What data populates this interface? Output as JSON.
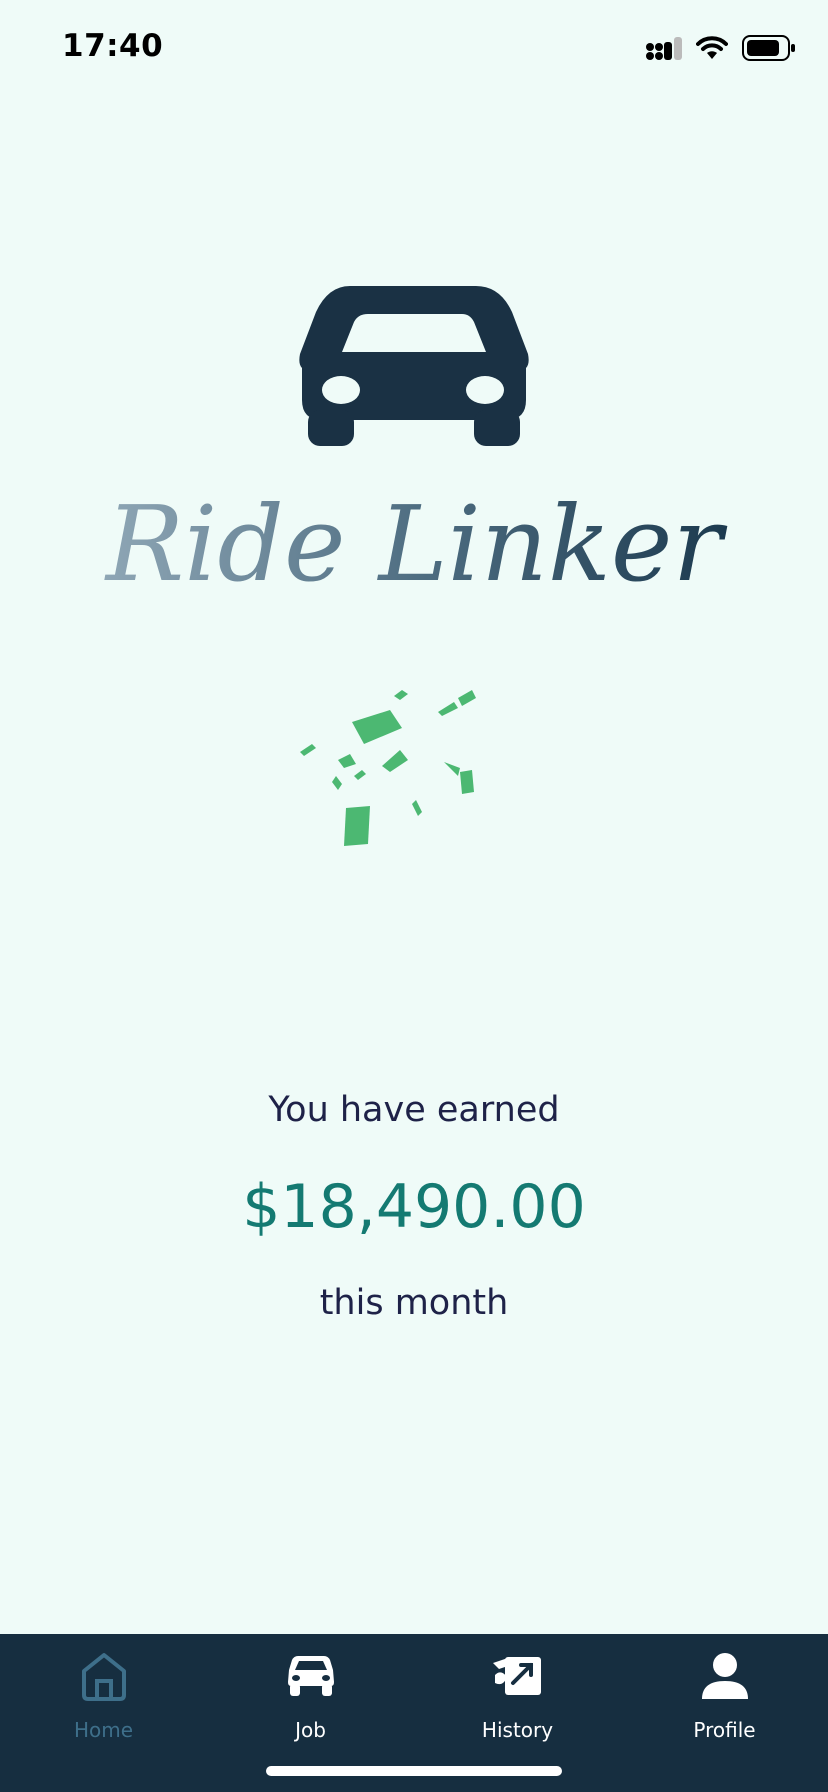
{
  "status_bar": {
    "time": "17:40"
  },
  "brand": {
    "logo_text": "Ride Linker",
    "icon": "car-icon"
  },
  "earnings": {
    "label": "You have earned",
    "amount": "$18,490.00",
    "period": "this month"
  },
  "tabbar": {
    "tabs": [
      {
        "label": "Home",
        "icon": "home-icon",
        "active": true
      },
      {
        "label": "Job",
        "icon": "car-icon",
        "active": false
      },
      {
        "label": "History",
        "icon": "history-icon",
        "active": false
      },
      {
        "label": "Profile",
        "icon": "profile-icon",
        "active": false
      }
    ]
  },
  "colors": {
    "background": "#EFFBF8",
    "tabbar": "#162E40",
    "accent": "#147A72",
    "text_dark": "#1E2248",
    "money_green": "#4CB872",
    "inactive_tab": "#3E6F8A"
  }
}
